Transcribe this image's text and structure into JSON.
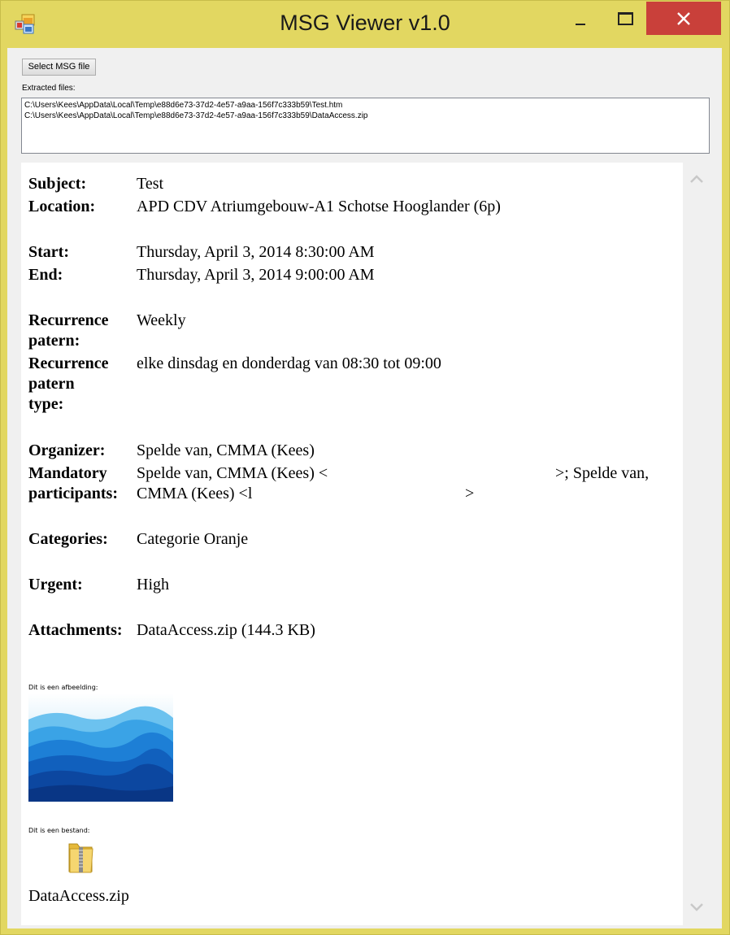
{
  "window": {
    "title": "MSG Viewer v1.0"
  },
  "toolbar": {
    "select_button": "Select MSG file",
    "extracted_label": "Extracted files:"
  },
  "extracted_files": [
    "C:\\Users\\Kees\\AppData\\Local\\Temp\\e88d6e73-37d2-4e57-a9aa-156f7c333b59\\Test.htm",
    "C:\\Users\\Kees\\AppData\\Local\\Temp\\e88d6e73-37d2-4e57-a9aa-156f7c333b59\\DataAccess.zip"
  ],
  "message": {
    "subject_label": "Subject:",
    "subject": "Test",
    "location_label": "Location:",
    "location": "APD CDV Atriumgebouw-A1 Schotse Hooglander (6p)",
    "start_label": "Start:",
    "start": "Thursday, April 3, 2014 8:30:00 AM",
    "end_label": "End:",
    "end": "Thursday, April 3, 2014 9:00:00 AM",
    "recurrence_label_1": "Recurrence",
    "recurrence_label_2": "patern:",
    "recurrence": "Weekly",
    "recurrence_type_label_1": "Recurrence",
    "recurrence_type_label_2": "patern",
    "recurrence_type_label_3": "type:",
    "recurrence_type": "elke dinsdag en donderdag van 08:30 tot 09:00",
    "organizer_label": "Organizer:",
    "organizer": "Spelde van, CMMA (Kees)",
    "mandatory_label_1": "Mandatory",
    "mandatory_label_2": "participants:",
    "mandatory_line_1a": "Spelde van, CMMA (Kees) <",
    "mandatory_line_1b": ">; Spelde van,",
    "mandatory_line_2a": "CMMA (Kees) <l",
    "mandatory_line_2b": ">",
    "categories_label": "Categories:",
    "categories": "Categorie Oranje",
    "urgent_label": "Urgent:",
    "urgent": "High",
    "attachments_label": "Attachments:",
    "attachments": "DataAccess.zip (144.3 KB)"
  },
  "body": {
    "image_caption": "Dit is een afbeelding:",
    "file_caption": "Dit is een bestand:",
    "file_name": "DataAccess.zip"
  },
  "colors": {
    "title_bar": "#e2d761",
    "close_button": "#c9403a"
  }
}
